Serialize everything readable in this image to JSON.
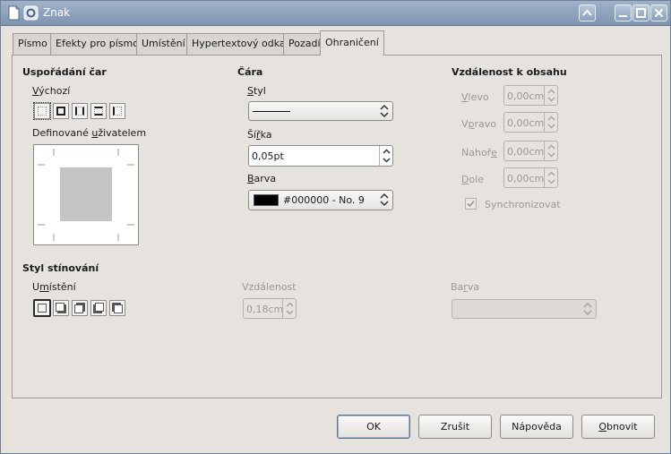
{
  "window": {
    "title": "Znak"
  },
  "tabs": [
    {
      "label": "Písmo"
    },
    {
      "label": "Efekty pro písmo"
    },
    {
      "label": "Umístění"
    },
    {
      "label": "Hypertextový odkaz"
    },
    {
      "label": "Pozadí"
    },
    {
      "label": "Ohraničení",
      "active": true
    }
  ],
  "line_arrangement": {
    "heading": "Uspořádání čar",
    "default_label_u": "V",
    "default_label_rest": "ýchozí",
    "user_defined_pre": "Definované ",
    "user_defined_u": "u",
    "user_defined_rest": "živatelem"
  },
  "line": {
    "heading": "Čára",
    "style_u": "S",
    "style_rest": "tyl",
    "width_pre": "Ší",
    "width_u": "ř",
    "width_rest": "ka",
    "width_value": "0,05pt",
    "color_u": "B",
    "color_rest": "arva",
    "color_value": "#000000 - No. 9",
    "color_swatch": "#000000"
  },
  "spacing": {
    "heading": "Vzdálenost k obsahu",
    "left_u": "V",
    "left_rest": "levo",
    "left_value": "0,00cm",
    "right_pre": "V",
    "right_u": "p",
    "right_rest": "ravo",
    "right_value": "0,00cm",
    "top_pre": "Nahoř",
    "top_u": "e",
    "top_rest": "",
    "top_value": "0,00cm",
    "bottom_u": "D",
    "bottom_rest": "ole",
    "bottom_value": "0,00cm",
    "sync_label": "Synchronizovat",
    "sync_checked": true
  },
  "shadow": {
    "heading": "Styl stínování",
    "position_pre": "U",
    "position_u": "m",
    "position_rest": "ístění",
    "distance_label": "Vzdálenost",
    "distance_value": "0,18cm",
    "color_label_pre": "Ba",
    "color_label_u": "r",
    "color_label_rest": "va"
  },
  "buttons": {
    "ok": "OK",
    "cancel": "Zrušit",
    "help": "Nápověda",
    "reset_u": "O",
    "reset_rest": "bnovit"
  }
}
